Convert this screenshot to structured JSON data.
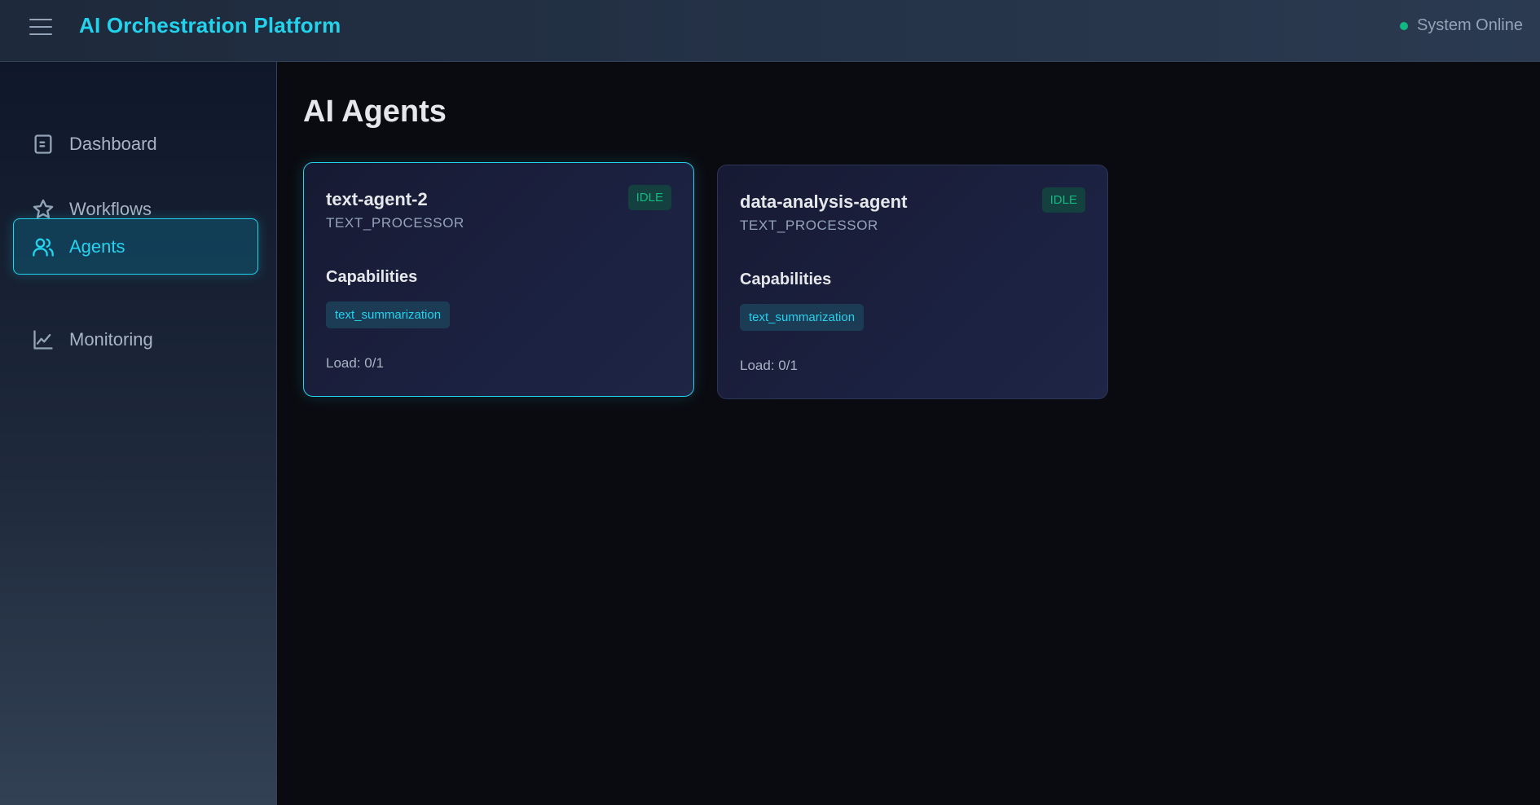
{
  "header": {
    "title": "AI Orchestration Platform",
    "status_text": "System Online",
    "status_color": "#10b981"
  },
  "sidebar": {
    "items": [
      {
        "label": "Dashboard",
        "icon": "dashboard-icon",
        "active": false
      },
      {
        "label": "Workflows",
        "icon": "star-icon",
        "active": false
      },
      {
        "label": "Agents",
        "icon": "users-icon",
        "active": true
      },
      {
        "label": "Monitoring",
        "icon": "chart-line-icon",
        "active": false
      }
    ]
  },
  "main": {
    "title": "AI Agents",
    "capabilities_heading": "Capabilities",
    "agents": [
      {
        "name": "text-agent-2",
        "type": "TEXT_PROCESSOR",
        "status": "IDLE",
        "capabilities": [
          "text_summarization"
        ],
        "load": "Load: 0/1",
        "selected": true
      },
      {
        "name": "data-analysis-agent",
        "type": "TEXT_PROCESSOR",
        "status": "IDLE",
        "capabilities": [
          "text_summarization"
        ],
        "load": "Load: 0/1",
        "selected": false
      }
    ]
  },
  "colors": {
    "accent": "#22d3ee",
    "status_idle": "#10b981",
    "background": "#0a0b10"
  }
}
